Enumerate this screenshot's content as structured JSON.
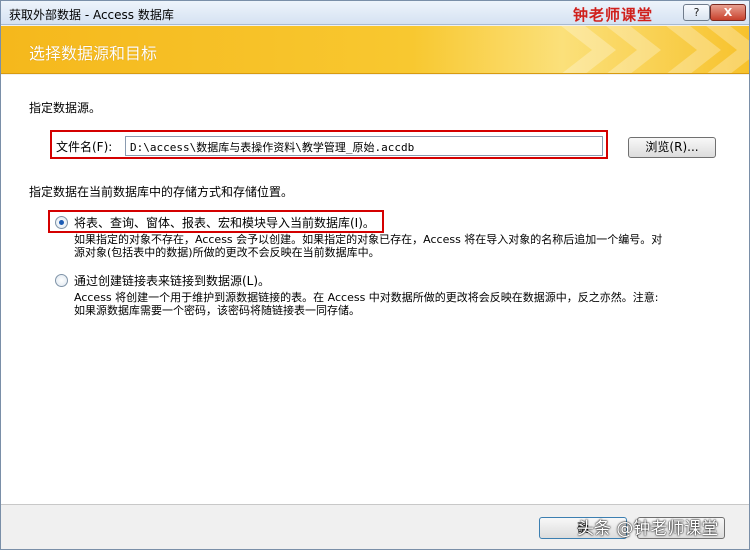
{
  "window": {
    "title": "获取外部数据 - Access 数据库",
    "brand": "钟老师课堂",
    "help_label": "?",
    "close_label": "X"
  },
  "banner": {
    "title": "选择数据源和目标"
  },
  "source": {
    "heading": "指定数据源。",
    "file_label": "文件名(F):",
    "file_value": "D:\\access\\数据库与表操作资料\\教学管理_原始.accdb",
    "browse_label": "浏览(R)..."
  },
  "storage": {
    "heading": "指定数据在当前数据库中的存储方式和存储位置。",
    "options": [
      {
        "label": "将表、查询、窗体、报表、宏和模块导入当前数据库(I)。",
        "checked": true,
        "desc_lines": [
          "如果指定的对象不存在，Access 会予以创建。如果指定的对象已存在，Access 将在导入对象的名称后追加一个编号。对",
          "源对象(包括表中的数据)所做的更改不会反映在当前数据库中。"
        ]
      },
      {
        "label": "通过创建链接表来链接到数据源(L)。",
        "checked": false,
        "desc_lines": [
          "Access 将创建一个用于维护到源数据链接的表。在 Access 中对数据所做的更改将会反映在数据源中，反之亦然。注意:",
          "如果源数据库需要一个密码，该密码将随链接表一同存储。"
        ]
      }
    ]
  },
  "footer": {
    "ok_label": "确",
    "watermark": "头条 @钟老师课堂"
  }
}
